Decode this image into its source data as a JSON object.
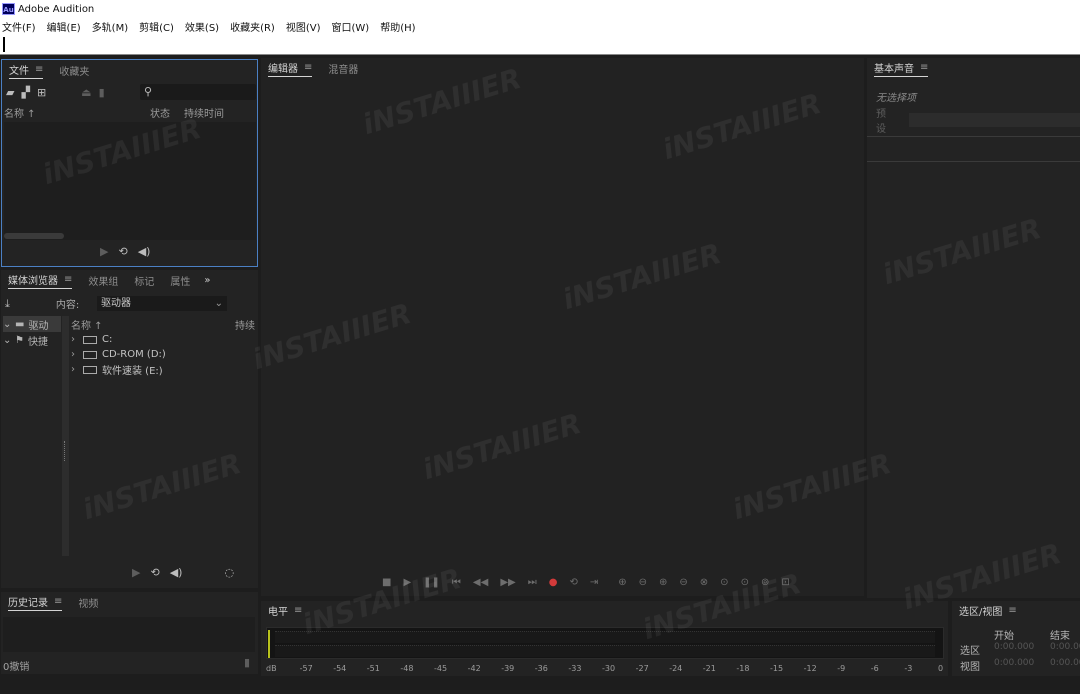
{
  "window": {
    "logo": "Au",
    "title": "Adobe Audition"
  },
  "menu": [
    "文件(F)",
    "编辑(E)",
    "多轨(M)",
    "剪辑(C)",
    "效果(S)",
    "收藏夹(R)",
    "视图(V)",
    "窗口(W)",
    "帮助(H)"
  ],
  "files_panel": {
    "tabs": [
      "文件",
      "收藏夹"
    ],
    "columns": {
      "name": "名称 ↑",
      "status": "状态",
      "duration": "持续时间"
    }
  },
  "media_panel": {
    "tabs": [
      "媒体浏览器",
      "效果组",
      "标记",
      "属性"
    ],
    "content_label": "内容:",
    "content_value": "驱动器",
    "left_tree": [
      "驱动",
      "快捷"
    ],
    "list_header": {
      "name": "名称 ↑",
      "duration": "持续"
    },
    "drives": [
      "C:",
      "CD-ROM (D:)",
      "软件速装 (E:)"
    ]
  },
  "history_panel": {
    "tabs": [
      "历史记录",
      "视频"
    ],
    "undo_count": "0撤销"
  },
  "editor_panel": {
    "tabs": [
      "编辑器",
      "混音器"
    ]
  },
  "essential_sound": {
    "title": "基本声音",
    "no_selection": "无选择项",
    "preset_label": "预设"
  },
  "levels_panel": {
    "title": "电平",
    "scale": [
      "dB",
      "-57",
      "-54",
      "-51",
      "-48",
      "-45",
      "-42",
      "-39",
      "-36",
      "-33",
      "-30",
      "-27",
      "-24",
      "-21",
      "-18",
      "-15",
      "-12",
      "-9",
      "-6",
      "-3",
      "0"
    ]
  },
  "selection_view": {
    "title": "选区/视图",
    "col_start": "开始",
    "col_end": "结束",
    "rows": [
      {
        "label": "选区",
        "start": "0:00.000",
        "end": "0:00.000"
      },
      {
        "label": "视图",
        "start": "0:00.000",
        "end": "0:00.000"
      }
    ]
  },
  "watermark": "iNSTAIIIER",
  "colors": {
    "background": "#1d1d1d",
    "panel": "#232323",
    "focus_border": "#4b80c4",
    "record": "#d23a3a",
    "meter_peak": "#b8c21c"
  }
}
